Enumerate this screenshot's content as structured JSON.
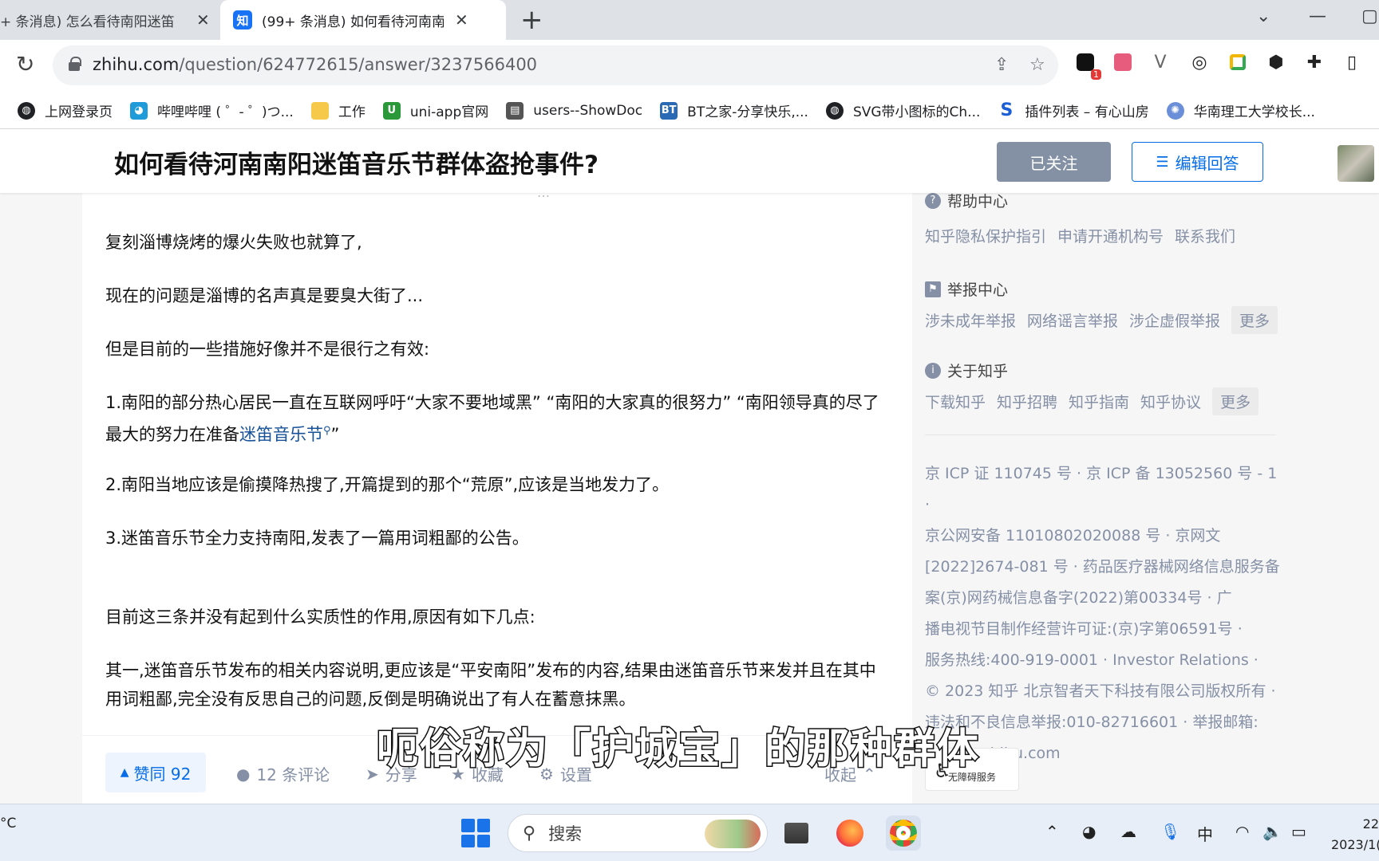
{
  "browser": {
    "tabs": [
      {
        "title": "+ 条消息) 怎么看待南阳迷笛",
        "close": "✕"
      },
      {
        "title": "(99+ 条消息) 如何看待河南南阳",
        "favicon": "知",
        "close": "✕"
      }
    ],
    "new_tab": "+",
    "url_host": "zhihu.com",
    "url_path": "/question/624772615/answer/3237566400",
    "extension_badge": "1"
  },
  "bookmarks": [
    {
      "label": "上网登录页",
      "icon": "globe-icon",
      "color": "#202124"
    },
    {
      "label": "哔哩哔哩 ( ゜- ゜)つ...",
      "icon": "bilibili-icon",
      "color": "#1e9bd8"
    },
    {
      "label": "工作",
      "icon": "folder-icon",
      "color": "#f6c94a"
    },
    {
      "label": "uni-app官网",
      "icon": "uniapp-icon",
      "color": "#2b9939"
    },
    {
      "label": "users--ShowDoc",
      "icon": "doc-icon",
      "color": "#555"
    },
    {
      "label": "BT之家-分享快乐,...",
      "icon": "bt-icon",
      "color": "#2a6ab5"
    },
    {
      "label": "SVG带小图标的Ch...",
      "icon": "globe-icon",
      "color": "#202124"
    },
    {
      "label": "插件列表 – 有心山房",
      "icon": "s-icon",
      "color": "#1b5fd6"
    },
    {
      "label": "华南理工大学校长...",
      "icon": "university-icon",
      "color": "#6a8fd8"
    }
  ],
  "header": {
    "question_title": "如何看待河南南阳迷笛音乐节群体盗抢事件?",
    "followed_label": "已关注",
    "edit_answer_label": "编辑回答"
  },
  "answer": {
    "cut_hint": "…",
    "paragraphs": {
      "p1": "复刻淄博烧烤的爆火失败也就算了,",
      "p2": "现在的问题是淄博的名声真是要臭大街了...",
      "p3": "但是目前的一些措施好像并不是很行之有效:",
      "p4_pre": "1.南阳的部分热心居民一直在互联网呼吁“大家不要地域黑” “南阳的大家真的很努力” “南阳领导真的尽了最大的努力在准备",
      "p4_link": "迷笛音乐节",
      "p4_post": "”",
      "p5": "2.南阳当地应该是偷摸降热搜了,开篇提到的那个“荒原”,应该是当地发力了。",
      "p6": "3.迷笛音乐节全力支持南阳,发表了一篇用词粗鄙的公告。",
      "p7": "目前这三条并没有起到什么实质性的作用,原因有如下几点:",
      "p8": "其一,迷笛音乐节发布的相关内容说明,更应该是“平安南阳”发布的内容,结果由迷笛音乐节来发并且在其中用词粗鄙,完全没有反思自己的问题,反倒是明确说出了有人在蓄意抹黑。"
    },
    "actions": {
      "vote": "赞同 92",
      "comments": "12 条评论",
      "share": "分享",
      "favorite": "收藏",
      "settings": "设置",
      "collapse": "收起"
    }
  },
  "sidebar": {
    "help": {
      "title": "帮助中心",
      "links": [
        "知乎隐私保护指引",
        "申请开通机构号",
        "联系我们"
      ]
    },
    "report": {
      "title": "举报中心",
      "links": [
        "涉未成年举报",
        "网络谣言举报",
        "涉企虚假举报"
      ],
      "more": "更多"
    },
    "about": {
      "title": "关于知乎",
      "links": [
        "下载知乎",
        "知乎招聘",
        "知乎指南",
        "知乎协议"
      ],
      "more": "更多"
    },
    "license_lines": [
      "京 ICP 证 110745 号 · 京 ICP 备 13052560 号 - 1 ·",
      "京公网安备 11010802020088 号 · 京网文",
      "[2022]2674-081 号 · 药品医疗器械网络信息服务备",
      "案(京)网药械信息备字(2022)第00334号 · 广",
      "播电视节目制作经营许可证:(京)字第06591号 ·",
      "服务热线:400-919-0001 · Investor Relations ·",
      "© 2023 知乎 北京智者天下科技有限公司版权所有 ·",
      "违法和不良信息举报:010-82716601 · 举报邮箱:",
      "jubao@zhihu.com"
    ],
    "accessibility": "无障碍服务"
  },
  "subtitle": "呃俗称为「护城宝」的那种群体",
  "taskbar": {
    "weather": "°C",
    "search_placeholder": "搜索",
    "ime": "中",
    "time": "22",
    "date": "2023/1("
  }
}
